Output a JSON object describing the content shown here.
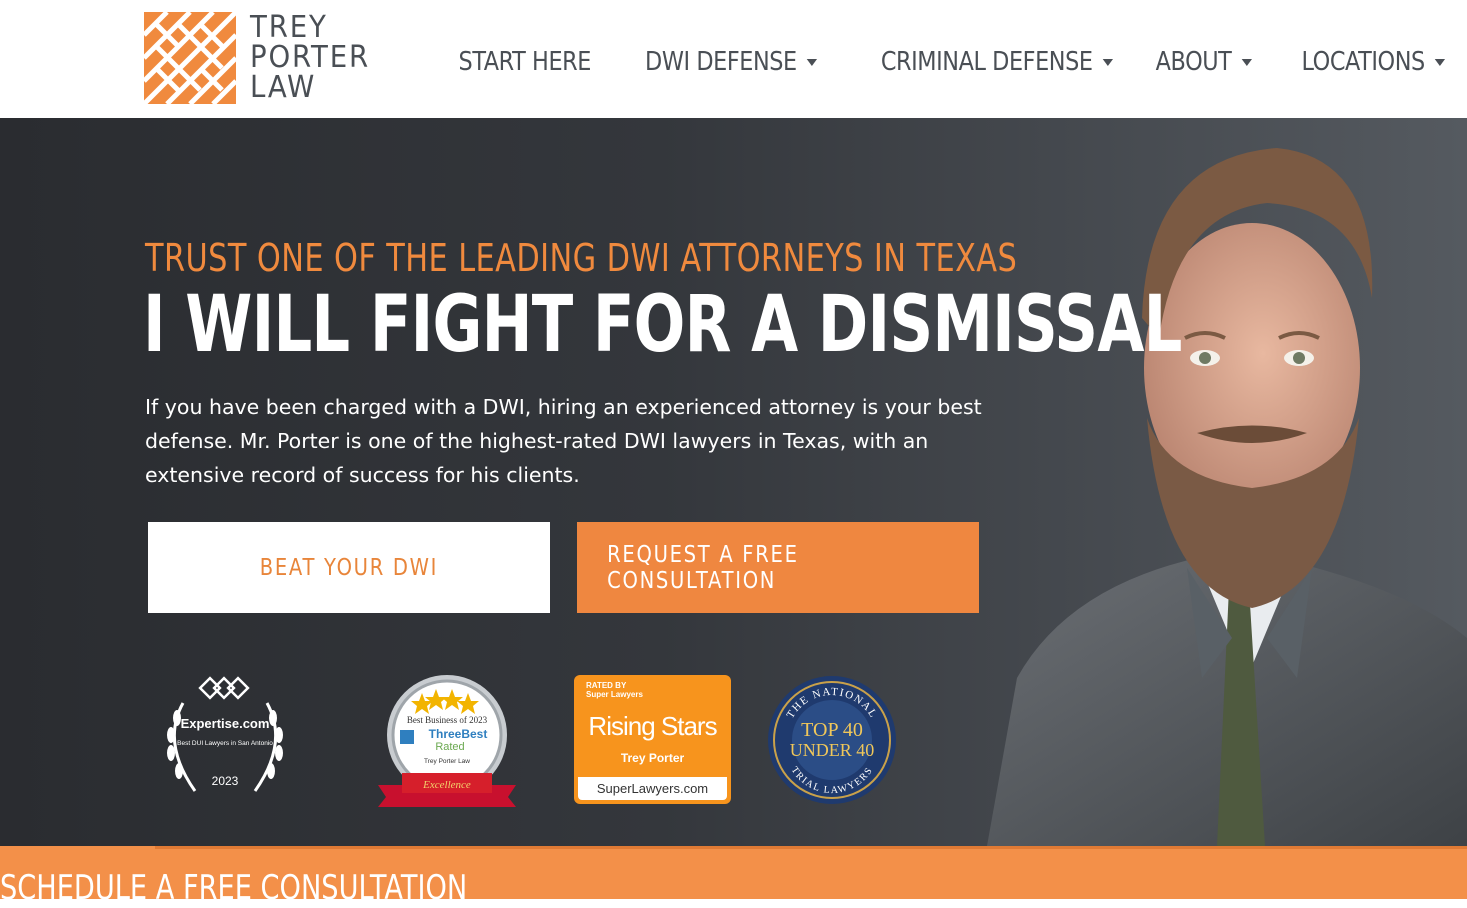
{
  "brand": {
    "line1": "TREY",
    "line2": "PORTER",
    "line3": "LAW",
    "color_orange": "#f08a3e",
    "color_text": "#4a4f55"
  },
  "nav": {
    "items": [
      {
        "label": "START HERE",
        "has_dropdown": false
      },
      {
        "label": "DWI DEFENSE",
        "has_dropdown": true
      },
      {
        "label": "CRIMINAL DEFENSE",
        "has_dropdown": true
      },
      {
        "label": "ABOUT",
        "has_dropdown": true
      },
      {
        "label": "LOCATIONS",
        "has_dropdown": true
      }
    ]
  },
  "hero": {
    "eyebrow": "TRUST ONE OF THE LEADING DWI ATTORNEYS IN TEXAS",
    "headline": "I WILL FIGHT FOR A DISMISSAL",
    "intro": "If you have been charged with a DWI, hiring an experienced attorney is your best defense. Mr. Porter is one of the highest-rated DWI lawyers in Texas, with an extensive record of success for his clients.",
    "primary_button": "BEAT YOUR DWI",
    "secondary_button": "REQUEST A FREE CONSULTATION"
  },
  "badges": {
    "expertise": {
      "site": "Expertise.com",
      "award": "Best DUI Lawyers in San Antonio",
      "year": "2023"
    },
    "threebest": {
      "title": "Best Business of 2023",
      "brand_line1": "ThreeBest",
      "brand_line2": "Rated",
      "firm": "Trey Porter Law",
      "ribbon": "Excellence"
    },
    "superlawyers": {
      "rated_line1": "RATED BY",
      "rated_line2": "Super Lawyers",
      "title": "Rising Stars",
      "name": "Trey Porter",
      "site": "SuperLawyers.com"
    },
    "top40": {
      "arc_top": "THE NATIONAL",
      "line1": "TOP 40",
      "line2": "UNDER 40",
      "arc_bottom": "TRIAL LAWYERS"
    }
  },
  "footer_strip": {
    "title": "SCHEDULE A FREE CONSULTATION"
  }
}
